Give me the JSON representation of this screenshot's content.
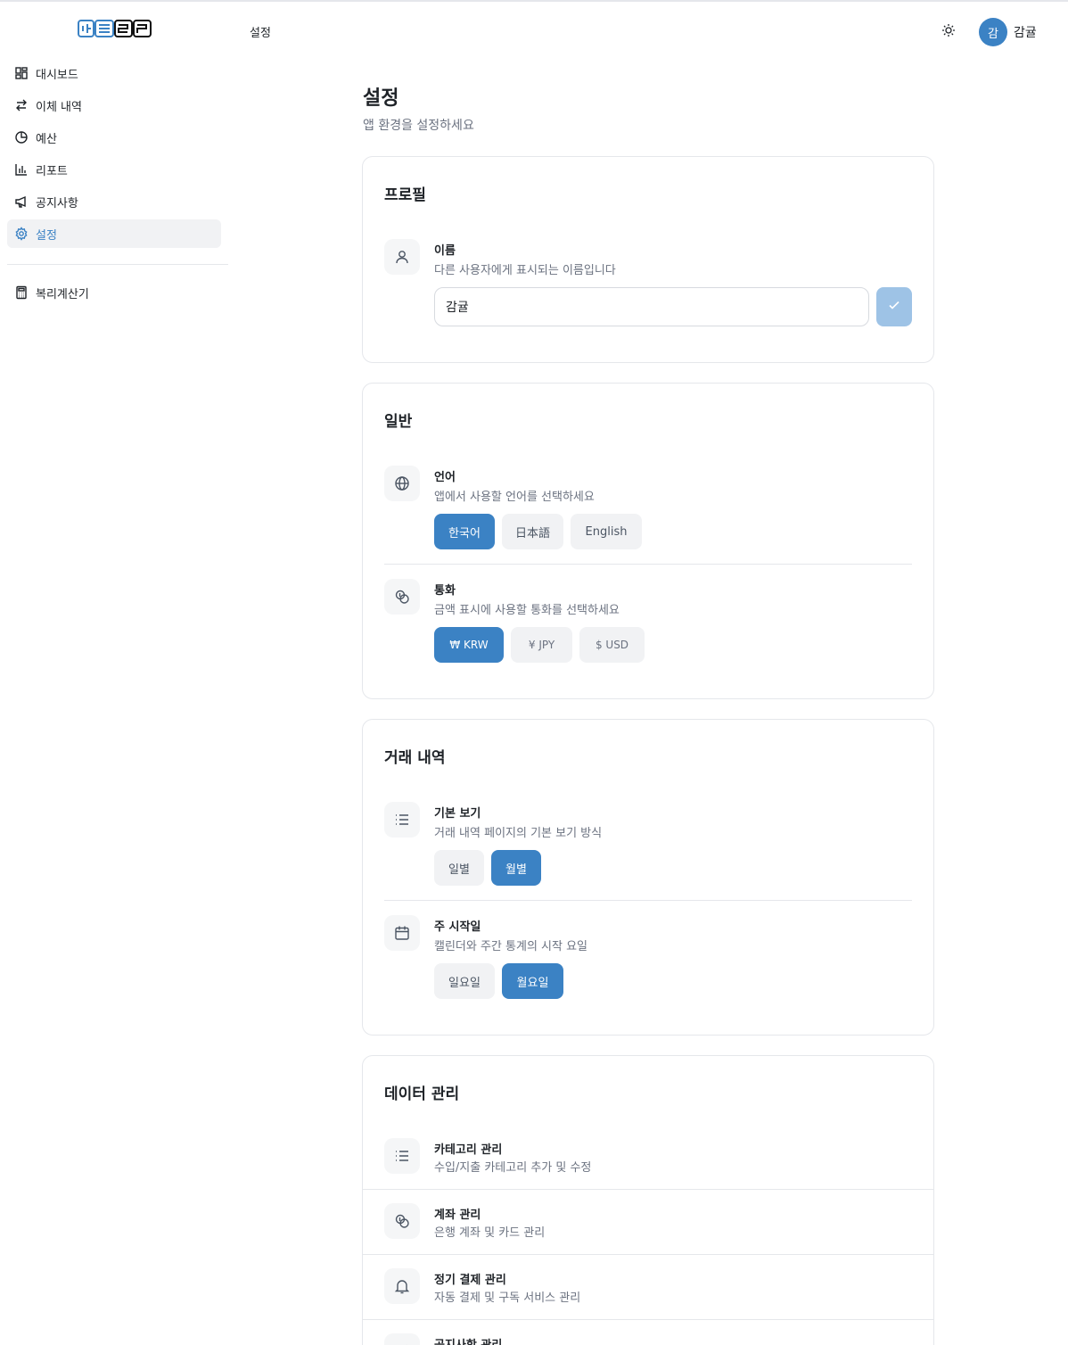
{
  "header": {
    "breadcrumb": "설정",
    "user": {
      "avatar_initial": "감",
      "name": "감귤"
    }
  },
  "sidebar": {
    "items": [
      {
        "label": "대시보드",
        "icon": "dashboard-icon"
      },
      {
        "label": "이체 내역",
        "icon": "transfer-icon"
      },
      {
        "label": "예산",
        "icon": "pie-chart-icon"
      },
      {
        "label": "리포트",
        "icon": "bar-chart-icon"
      },
      {
        "label": "공지사항",
        "icon": "megaphone-icon"
      },
      {
        "label": "설정",
        "icon": "gear-icon",
        "active": true
      }
    ],
    "tools": [
      {
        "label": "복리계산기",
        "icon": "calculator-icon"
      }
    ]
  },
  "page": {
    "title": "설정",
    "subtitle": "앱 환경을 설정하세요"
  },
  "profile": {
    "title": "프로필",
    "name_label": "이름",
    "name_desc": "다른 사용자에게 표시되는 이름입니다",
    "name_value": "감귤"
  },
  "general": {
    "title": "일반",
    "language": {
      "label": "언어",
      "desc": "앱에서 사용할 언어를 선택하세요",
      "options": [
        "한국어",
        "日本語",
        "English"
      ],
      "selected": "한국어"
    },
    "currency": {
      "label": "통화",
      "desc": "금액 표시에 사용할 통화를 선택하세요",
      "options": [
        {
          "symbol": "₩",
          "code": "KRW"
        },
        {
          "symbol": "¥",
          "code": "JPY"
        },
        {
          "symbol": "$",
          "code": "USD"
        }
      ],
      "selected": "KRW"
    }
  },
  "transactions": {
    "title": "거래 내역",
    "default_view": {
      "label": "기본 보기",
      "desc": "거래 내역 페이지의 기본 보기 방식",
      "options": [
        "일별",
        "월별"
      ],
      "selected": "월별"
    },
    "week_start": {
      "label": "주 시작일",
      "desc": "캘린더와 주간 통계의 시작 요일",
      "options": [
        "일요일",
        "월요일"
      ],
      "selected": "월요일"
    }
  },
  "data_management": {
    "title": "데이터 관리",
    "items": [
      {
        "label": "카테고리 관리",
        "desc": "수입/지출 카테고리 추가 및 수정",
        "icon": "list-icon"
      },
      {
        "label": "계좌 관리",
        "desc": "은행 계좌 및 카드 관리",
        "icon": "coins-icon"
      },
      {
        "label": "정기 결제 관리",
        "desc": "자동 결제 및 구독 서비스 관리",
        "icon": "bell-icon"
      },
      {
        "label": "공지사항 관리",
        "desc": "",
        "icon": "megaphone-icon"
      }
    ]
  },
  "colors": {
    "accent": "#3b82c4",
    "accent_disabled": "#9ec3e6",
    "muted_bg": "#f1f2f4",
    "border": "#e5e7eb"
  }
}
